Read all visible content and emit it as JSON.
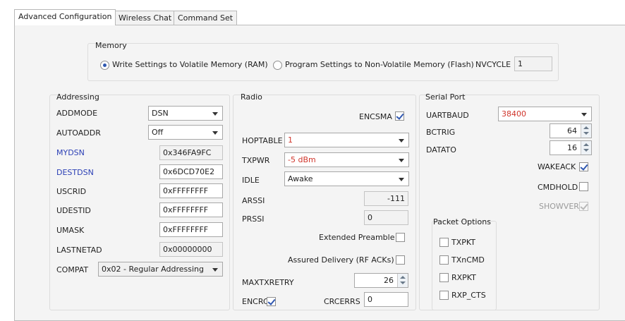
{
  "tabs": [
    "Advanced Configuration",
    "Wireless Chat",
    "Command Set"
  ],
  "memory": {
    "title": "Memory",
    "option_volatile": "Write Settings to Volatile Memory (RAM)",
    "option_flash": "Program Settings to Non-Volatile Memory (Flash)",
    "selected": "volatile",
    "nvcycle_label": "NVCYCLE",
    "nvcycle_value": "1"
  },
  "addressing": {
    "title": "Addressing",
    "addmode_label": "ADDMODE",
    "addmode_value": "DSN",
    "autoaddr_label": "AUTOADDR",
    "autoaddr_value": "Off",
    "mydsn_label": "MYDSN",
    "mydsn_value": "0x346FA9FC",
    "destdsn_label": "DESTDSN",
    "destdsn_value": "0x6DCD70E2",
    "uscrid_label": "USCRID",
    "uscrid_value": "0xFFFFFFFF",
    "udestid_label": "UDESTID",
    "udestid_value": "0xFFFFFFFF",
    "umask_label": "UMASK",
    "umask_value": "0xFFFFFFFF",
    "lastnetad_label": "LASTNETAD",
    "lastnetad_value": "0x00000000",
    "compat_label": "COMPAT",
    "compat_value": "0x02 - Regular Addressing"
  },
  "radio": {
    "title": "Radio",
    "encsma_label": "ENCSMA",
    "encsma_checked": true,
    "hoptable_label": "HOPTABLE",
    "hoptable_value": "1",
    "txpwr_label": "TXPWR",
    "txpwr_value": "-5 dBm",
    "idle_label": "IDLE",
    "idle_value": "Awake",
    "arssi_label": "ARSSI",
    "arssi_value": "-111",
    "prssi_label": "PRSSI",
    "prssi_value": "0",
    "extended_preamble_label": "Extended Preamble",
    "extended_preamble_checked": false,
    "assured_delivery_label": "Assured Delivery (RF ACKs)",
    "assured_delivery_checked": false,
    "maxtxretry_label": "MAXTXRETRY",
    "maxtxretry_value": "26",
    "encrc_label": "ENCRC",
    "encrc_checked": true,
    "crcerrs_label": "CRCERRS",
    "crcerrs_value": "0"
  },
  "serial": {
    "title": "Serial Port",
    "uartbaud_label": "UARTBAUD",
    "uartbaud_value": "38400",
    "bctrig_label": "BCTRIG",
    "bctrig_value": "64",
    "datato_label": "DATATO",
    "datato_value": "16",
    "wakeack_label": "WAKEACK",
    "wakeack_checked": true,
    "cmdhold_label": "CMDHOLD",
    "cmdhold_checked": false,
    "showver_label": "SHOWVER",
    "showver_checked": true,
    "packet_options": {
      "title": "Packet Options",
      "txpkt_label": "TXPKT",
      "txncmd_label": "TXnCMD",
      "rxpkt_label": "RXPKT",
      "rxp_cts_label": "RXP_CTS"
    }
  },
  "colors": {
    "changed_value": "#d0352b",
    "modified_label": "#2b3fb5",
    "panel_bg": "#f4f4f4"
  }
}
